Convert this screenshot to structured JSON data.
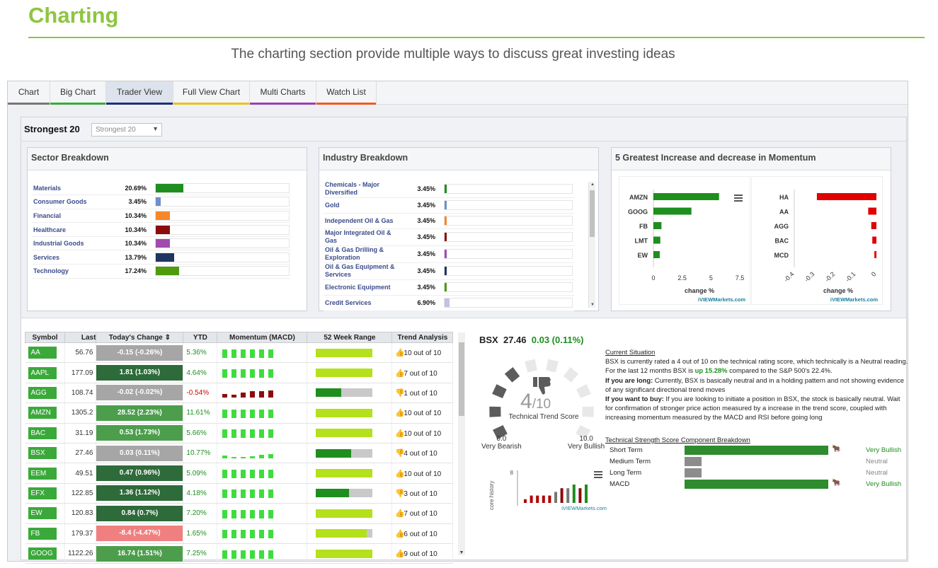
{
  "page": {
    "title": "Charting",
    "subtitle": "The charting section provide multiple ways to discuss great investing ideas"
  },
  "tabs": [
    {
      "label": "Chart",
      "color": "#777777"
    },
    {
      "label": "Big Chart",
      "color": "#3aa93a"
    },
    {
      "label": "Trader View",
      "color": "#1f2f7a",
      "active": true
    },
    {
      "label": "Full View Chart",
      "color": "#e8c21d"
    },
    {
      "label": "Multi Charts",
      "color": "#9b3fb5"
    },
    {
      "label": "Watch List",
      "color": "#f05a23"
    }
  ],
  "strongest": {
    "label": "Strongest 20",
    "select_value": "Strongest 20"
  },
  "sector": {
    "title": "Sector Breakdown",
    "rows": [
      {
        "name": "Materials",
        "pct": "20.69%",
        "value": 20.69,
        "color": "#1e8e1e"
      },
      {
        "name": "Consumer Goods",
        "pct": "3.45%",
        "value": 3.45,
        "color": "#6f8fca"
      },
      {
        "name": "Financial",
        "pct": "10.34%",
        "value": 10.34,
        "color": "#f5872b"
      },
      {
        "name": "Healthcare",
        "pct": "10.34%",
        "value": 10.34,
        "color": "#8b0c0c"
      },
      {
        "name": "Industrial Goods",
        "pct": "10.34%",
        "value": 10.34,
        "color": "#a24ab0"
      },
      {
        "name": "Services",
        "pct": "13.79%",
        "value": 13.79,
        "color": "#1f3560"
      },
      {
        "name": "Technology",
        "pct": "17.24%",
        "value": 17.24,
        "color": "#4f9a0f"
      }
    ]
  },
  "industry": {
    "title": "Industry Breakdown",
    "rows": [
      {
        "name": "Chemicals - Major Diversified",
        "pct": "3.45%",
        "value": 3.45,
        "color": "#1e8e1e"
      },
      {
        "name": "Gold",
        "pct": "3.45%",
        "value": 3.45,
        "color": "#6f8fca"
      },
      {
        "name": "Independent Oil & Gas",
        "pct": "3.45%",
        "value": 3.45,
        "color": "#f5872b"
      },
      {
        "name": "Major Integrated Oil & Gas",
        "pct": "3.45%",
        "value": 3.45,
        "color": "#8b0c0c"
      },
      {
        "name": "Oil & Gas Drilling & Exploration",
        "pct": "3.45%",
        "value": 3.45,
        "color": "#a24ab0"
      },
      {
        "name": "Oil & Gas Equipment & Services",
        "pct": "3.45%",
        "value": 3.45,
        "color": "#1f3560"
      },
      {
        "name": "Electronic Equipment",
        "pct": "3.45%",
        "value": 3.45,
        "color": "#4f9a0f"
      },
      {
        "name": "Credit Services",
        "pct": "6.90%",
        "value": 6.9,
        "color": "#c5c0e6"
      }
    ]
  },
  "momentum": {
    "title": "5 Greatest Increase and decrease in Momentum",
    "credit": "iVIEWMarkets.com",
    "chart_data": [
      {
        "type": "bar",
        "categories": [
          "AMZN",
          "GOOG",
          "FB",
          "LMT",
          "EW"
        ],
        "values": [
          5.7,
          3.3,
          0.7,
          0.6,
          0.55
        ],
        "xlabel": "change %",
        "xlim": [
          0,
          7.5
        ],
        "ticks": [
          "0",
          "2.5",
          "5",
          "7.5"
        ],
        "color": "#1e8e1e"
      },
      {
        "type": "bar",
        "categories": [
          "HA",
          "AA",
          "AGG",
          "BAC",
          "MCD"
        ],
        "values": [
          -0.29,
          -0.04,
          -0.025,
          -0.02,
          -0.01
        ],
        "xlabel": "change %",
        "xlim": [
          -0.4,
          0
        ],
        "ticks": [
          "-0.4",
          "-0.3",
          "-0.2",
          "-0.1",
          "0"
        ],
        "color": "#e00000"
      }
    ]
  },
  "table": {
    "headers": [
      "Symbol",
      "Last",
      "Today's Change",
      "YTD",
      "Momentum (MACD)",
      "52 Week Range",
      "Trend Analysis"
    ],
    "rows": [
      {
        "symbol": "AA",
        "last": "56.76",
        "change": "-0.15 (-0.26%)",
        "chg_color": "#a6a6a6",
        "ytd": "5.36%",
        "ytd_color": "#1e8e1e",
        "mom": [
          1,
          1,
          1,
          1,
          1,
          1
        ],
        "mom_color": "#3fdc3f",
        "range": 1.0,
        "range_color": "#b4e01c",
        "trend": "10 out of 10",
        "up": true
      },
      {
        "symbol": "AAPL",
        "last": "177.09",
        "change": "1.81 (1.03%)",
        "chg_color": "#2e6b3a",
        "ytd": "4.64%",
        "ytd_color": "#1e8e1e",
        "mom": [
          1,
          1,
          1,
          1,
          1,
          1
        ],
        "mom_color": "#3fdc3f",
        "range": 1.0,
        "range_color": "#b4e01c",
        "trend": "7 out of 10",
        "up": true
      },
      {
        "symbol": "AGG",
        "last": "108.74",
        "change": "-0.02 (-0.02%)",
        "chg_color": "#a6a6a6",
        "ytd": "-0.54%",
        "ytd_color": "#d00000",
        "mom": [
          0.45,
          0.35,
          0.6,
          0.75,
          0.8,
          0.85
        ],
        "mom_color": "#8b0c0c",
        "range": 0.45,
        "range_color": "#1e8e1e",
        "trend": "1 out of 10",
        "up": false
      },
      {
        "symbol": "AMZN",
        "last": "1305.2",
        "change": "28.52 (2.23%)",
        "chg_color": "#4c9e4c",
        "ytd": "11.61%",
        "ytd_color": "#1e8e1e",
        "mom": [
          1,
          1,
          1,
          1,
          1,
          1
        ],
        "mom_color": "#3fdc3f",
        "range": 1.0,
        "range_color": "#b4e01c",
        "trend": "10 out of 10",
        "up": true
      },
      {
        "symbol": "BAC",
        "last": "31.19",
        "change": "0.53 (1.73%)",
        "chg_color": "#4c9e4c",
        "ytd": "5.66%",
        "ytd_color": "#1e8e1e",
        "mom": [
          1,
          1,
          1,
          1,
          1,
          1
        ],
        "mom_color": "#3fdc3f",
        "range": 1.0,
        "range_color": "#b4e01c",
        "trend": "10 out of 10",
        "up": true
      },
      {
        "symbol": "BSX",
        "last": "27.46",
        "change": "0.03 (0.11%)",
        "chg_color": "#a6a6a6",
        "ytd": "10.77%",
        "ytd_color": "#1e8e1e",
        "mom": [
          0.3,
          0.15,
          0.1,
          0.2,
          0.35,
          0.5
        ],
        "mom_color": "#3fdc3f",
        "range": 0.62,
        "range_color": "#1e8e1e",
        "trend": "4 out of 10",
        "up": false
      },
      {
        "symbol": "EEM",
        "last": "49.51",
        "change": "0.47 (0.96%)",
        "chg_color": "#2e6b3a",
        "ytd": "5.09%",
        "ytd_color": "#1e8e1e",
        "mom": [
          1,
          1,
          1,
          1,
          1,
          1
        ],
        "mom_color": "#3fdc3f",
        "range": 1.0,
        "range_color": "#b4e01c",
        "trend": "10 out of 10",
        "up": true
      },
      {
        "symbol": "EFX",
        "last": "122.85",
        "change": "1.36 (1.12%)",
        "chg_color": "#2e6b3a",
        "ytd": "4.18%",
        "ytd_color": "#1e8e1e",
        "mom": [
          1,
          1,
          1,
          1,
          1,
          1
        ],
        "mom_color": "#3fdc3f",
        "range": 0.58,
        "range_color": "#1e8e1e",
        "trend": "3 out of 10",
        "up": false
      },
      {
        "symbol": "EW",
        "last": "120.83",
        "change": "0.84 (0.7%)",
        "chg_color": "#2e6b3a",
        "ytd": "7.20%",
        "ytd_color": "#1e8e1e",
        "mom": [
          1,
          1,
          1,
          1,
          1,
          1
        ],
        "mom_color": "#3fdc3f",
        "range": 1.0,
        "range_color": "#b4e01c",
        "trend": "7 out of 10",
        "up": true
      },
      {
        "symbol": "FB",
        "last": "179.37",
        "change": "-8.4 (-4.47%)",
        "chg_color": "#f08080",
        "ytd": "1.65%",
        "ytd_color": "#1e8e1e",
        "mom": [
          1,
          1,
          1,
          1,
          1,
          1
        ],
        "mom_color": "#3fdc3f",
        "range": 0.9,
        "range_color": "#b4e01c",
        "trend": "6 out of 10",
        "up": true
      },
      {
        "symbol": "GOOG",
        "last": "1122.26",
        "change": "16.74 (1.51%)",
        "chg_color": "#4c9e4c",
        "ytd": "7.25%",
        "ytd_color": "#1e8e1e",
        "mom": [
          1,
          1,
          1,
          1,
          1,
          1
        ],
        "mom_color": "#3fdc3f",
        "range": 1.0,
        "range_color": "#b4e01c",
        "trend": "9 out of 10",
        "up": true
      }
    ]
  },
  "detail": {
    "symbol": "BSX",
    "price": "27.46",
    "change": "0.03 (0.11%)",
    "score": "4",
    "score_max": "/10",
    "score_value": 4,
    "gauge_label": "Technical Trend Score",
    "low_value": "0.0",
    "low_label": "Very Bearish",
    "high_value": "10.0",
    "high_label": "Very Bullish",
    "history_axis": "Score history",
    "history_tick": "8",
    "history_credit": "iVIEWMarkets.com",
    "history": [
      1,
      2,
      2,
      2,
      2,
      3,
      4,
      4,
      5,
      4,
      5
    ],
    "history_colors": [
      "#b00000",
      "#b00000",
      "#b00000",
      "#b00000",
      "#b00000",
      "#777777",
      "#8b0c0c",
      "#777777",
      "#1e8e1e",
      "#8b0c0c",
      "#1e8e1e"
    ],
    "situation_heading": "Current Situation",
    "situation_p1a": "BSX is currently rated a 4 out of 10 on the technical rating score, which technically is a Neutral reading. For the last 12 months BSX is ",
    "situation_p1_highlight": "up 15.28%",
    "situation_p1b": " compared to the S&P 500's 22.4%.",
    "long_label": "If you are long:",
    "long_text": " Currently, BSX is basically neutral and in a holding pattern and not showing evidence of any significant directional trend moves",
    "buy_label": "If you want to buy:",
    "buy_text": " If you are looking to initiate a position in BSX, the stock is basically neutral. Wait for confirmation of stronger price action measured by a increase in the trend score, coupled with increasing momentum measured by the MACD and RSI before going long",
    "strength_heading": "Technical Strength Score Component Breakdown",
    "components": [
      {
        "name": "Short Term",
        "value": 1.0,
        "color": "#2e8b2e",
        "label": "Very Bullish",
        "label_color": "#1e8e1e",
        "bull": true
      },
      {
        "name": "Medium Term",
        "value": 0.12,
        "color": "#8c8c8c",
        "label": "Neutral",
        "label_color": "#888888",
        "bull": false
      },
      {
        "name": "Long Term",
        "value": 0.12,
        "color": "#8c8c8c",
        "label": "Neutral",
        "label_color": "#888888",
        "bull": false
      },
      {
        "name": "MACD",
        "value": 1.0,
        "color": "#2e8b2e",
        "label": "Very Bullish",
        "label_color": "#1e8e1e",
        "bull": true
      }
    ]
  }
}
